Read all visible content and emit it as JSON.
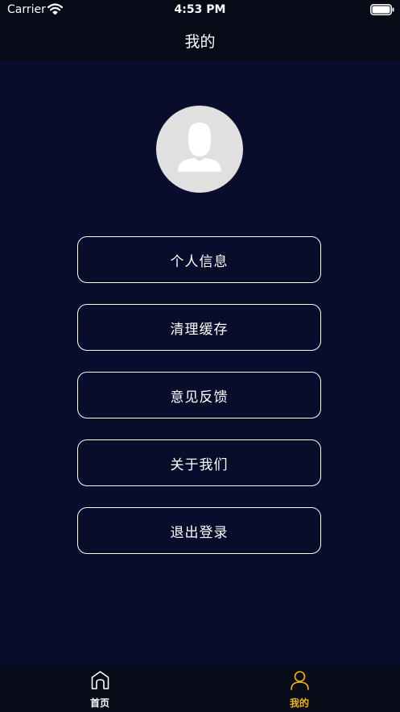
{
  "status_bar": {
    "carrier": "Carrier",
    "time": "4:53 PM"
  },
  "nav": {
    "title": "我的"
  },
  "menu": [
    {
      "label": "个人信息"
    },
    {
      "label": "清理缓存"
    },
    {
      "label": "意见反馈"
    },
    {
      "label": "关于我们"
    },
    {
      "label": "退出登录"
    }
  ],
  "tab_bar": {
    "tabs": [
      {
        "label": "首页",
        "icon": "home-icon",
        "color": "#ffffff",
        "active": false
      },
      {
        "label": "我的",
        "icon": "person-icon",
        "color": "#f5b800",
        "active": true
      }
    ]
  },
  "colors": {
    "background": "#070d2b",
    "bar_background": "#070a17",
    "accent": "#f5b800",
    "text": "#ffffff",
    "avatar_bg": "#e0e0e0"
  }
}
